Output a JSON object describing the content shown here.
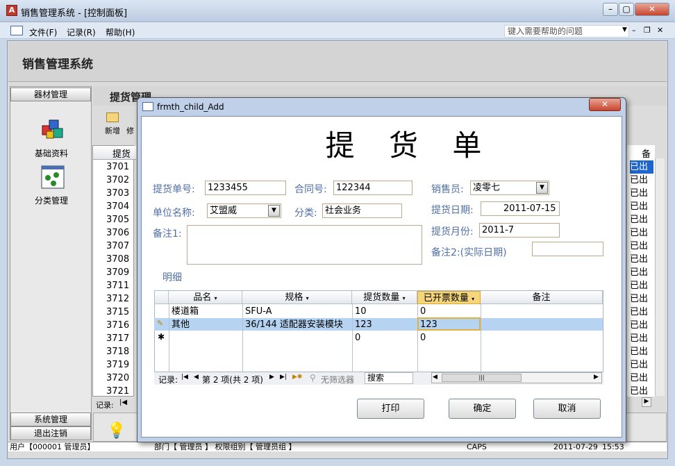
{
  "window": {
    "title": "销售管理系统 - [控制面板]",
    "icon": "A",
    "min": "–",
    "max": "▢",
    "close": "✕"
  },
  "menu": {
    "items": [
      "文件(F)",
      "记录(R)",
      "帮助(H)"
    ],
    "help_placeholder": "键入需要帮助的问题"
  },
  "header": {
    "title": "销售管理系统"
  },
  "sidebar": {
    "section1": "器材管理",
    "items": [
      {
        "label": "基础资料",
        "icon": "cubes-icon"
      },
      {
        "label": "分类管理",
        "icon": "nodes-icon"
      }
    ],
    "section2": "系统管理",
    "section3": "退出注销"
  },
  "panel": {
    "title": "提货管理",
    "tool_new": "新增",
    "tool_edit": "修",
    "col_head": "提货",
    "col_remark": "备",
    "record_label": "记录:"
  },
  "bg_rows": [
    "3701",
    "3702",
    "3703",
    "3704",
    "3705",
    "3706",
    "3707",
    "3708",
    "3709",
    "3711",
    "3712",
    "3715",
    "3716",
    "3717",
    "3718",
    "3719",
    "3720",
    "3721"
  ],
  "bg_right": "已出",
  "dialog": {
    "title": "frmth_child_Add",
    "close": "✕",
    "heading": "提 货 单",
    "fields": {
      "order_no_label": "提货单号:",
      "order_no": "1233455",
      "contract_label": "合同号:",
      "contract": "122344",
      "sales_label": "销售员:",
      "sales": "凌零七",
      "unit_label": "单位名称:",
      "unit": "艾盟威",
      "category_label": "分类:",
      "category": "社会业务",
      "date_label": "提货日期:",
      "date": "2011-07-15",
      "month_label": "提货月份:",
      "month": "2011-7",
      "note1_label": "备注1:",
      "note2_label": "备注2:(实际日期)"
    },
    "detail_label": "明细",
    "grid": {
      "headers": [
        "品名",
        "规格",
        "提货数量",
        "已开票数量",
        "备注"
      ],
      "rows": [
        {
          "name": "楼道箱",
          "spec": "SFU-A",
          "qty": "10",
          "invoiced": "0",
          "remark": ""
        },
        {
          "name": "其他",
          "spec": "36/144 适配器安装模块",
          "qty": "123",
          "invoiced": "123",
          "remark": ""
        },
        {
          "name": "",
          "spec": "",
          "qty": "0",
          "invoiced": "0",
          "remark": ""
        }
      ],
      "nav": {
        "label": "记录:",
        "position": "第 2 项(共 2 项)",
        "filter": "无筛选器",
        "search": "搜索"
      }
    },
    "buttons": {
      "print": "打印",
      "ok": "确定",
      "cancel": "取消"
    }
  },
  "status": {
    "user": "用户【000001 管理员】",
    "dept": "部门【 管理员 】 权限组别【 管理员组 】",
    "caps": "CAPS",
    "date": "2011-07-29",
    "time": "15:53"
  }
}
